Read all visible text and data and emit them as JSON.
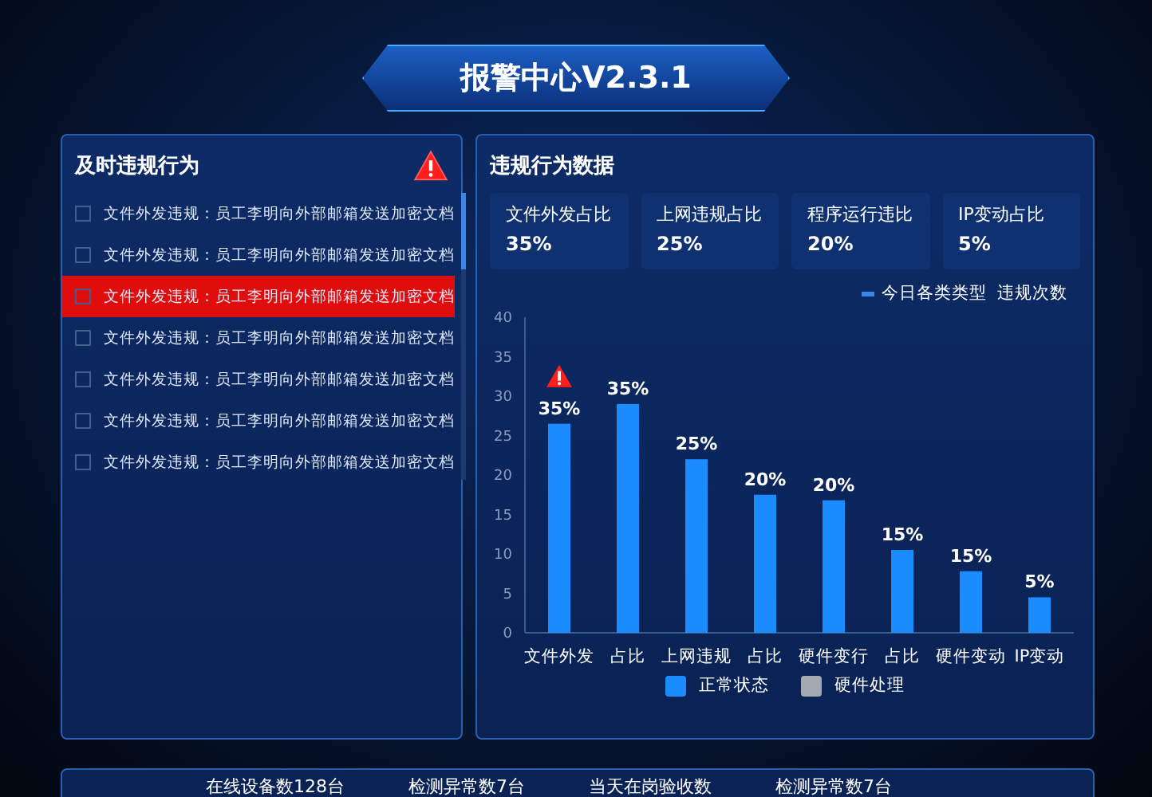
{
  "header": {
    "title": "报警中心V2.3.1"
  },
  "alerts_panel": {
    "title": "及时违规行为",
    "alert": true,
    "items": [
      {
        "text": "文件外发违规：员工李明向外部邮箱发送加密文档",
        "checked": false,
        "selected": false
      },
      {
        "text": "文件外发违规：员工李明向外部邮箱发送加密文档",
        "checked": false,
        "selected": false
      },
      {
        "text": "文件外发违规：员工李明向外部邮箱发送加密文档",
        "checked": false,
        "selected": true
      },
      {
        "text": "文件外发违规：员工李明向外部邮箱发送加密文档",
        "checked": false,
        "selected": false
      },
      {
        "text": "文件外发违规：员工李明向外部邮箱发送加密文档",
        "checked": false,
        "selected": false
      },
      {
        "text": "文件外发违规：员工李明向外部邮箱发送加密文档",
        "checked": false,
        "selected": false
      },
      {
        "text": "文件外发违规：员工李明向外部邮箱发送加密文档",
        "checked": false,
        "selected": false
      }
    ]
  },
  "data_panel": {
    "title": "违规行为数据",
    "stats": [
      {
        "label": "文件外发占比",
        "value": "35%"
      },
      {
        "label": "上网违规占比",
        "value": "25%"
      },
      {
        "label": "程序运行违比",
        "value": "20%"
      },
      {
        "label": "IP变动占比",
        "value": "5%"
      }
    ],
    "legend_title": "今日各类类型  违规次数",
    "chart_data": {
      "type": "bar",
      "categories": [
        "文件外发",
        "占比",
        "上网违规",
        "占比",
        "硬件变行",
        "占比",
        "硬件变动",
        "IP变动"
      ],
      "ylim": [
        0,
        40
      ],
      "yticks": [
        0,
        5,
        10,
        15,
        20,
        25,
        30,
        35,
        40
      ],
      "series": [
        {
          "name": "正常状态",
          "color": "#1b8cff",
          "values": [
            26.5,
            29,
            22,
            17.5,
            16.8,
            10.5,
            7.8,
            4.5
          ]
        },
        {
          "name": "硬件处理",
          "color": "#a4a9b0",
          "values": [
            null,
            null,
            null,
            null,
            null,
            null,
            null,
            null
          ]
        }
      ],
      "value_labels": [
        "35%",
        "35%",
        "25%",
        "20%",
        "20%",
        "15%",
        "15%",
        "5%"
      ]
    },
    "bar_alerts": [
      true,
      false,
      false,
      false,
      false,
      false,
      false,
      false
    ]
  },
  "status_bar": [
    "在线设备数128台",
    "检测异常数7台",
    "当天在岗验收数",
    "检测异常数7台"
  ]
}
